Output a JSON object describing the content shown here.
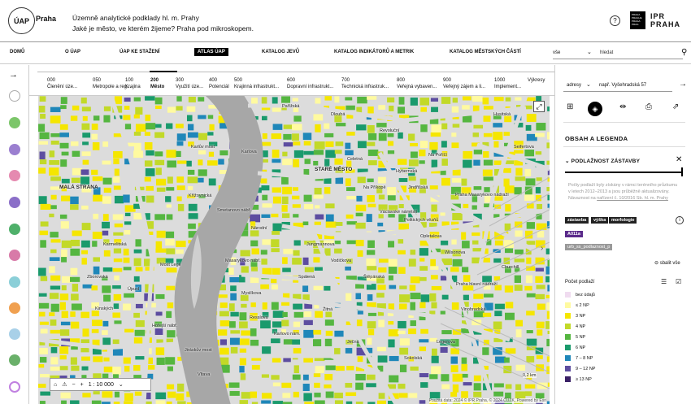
{
  "header": {
    "logo": "ÚAP",
    "logo_city": "Praha",
    "title_line1": "Územně analytické podklady hl. m. Prahy",
    "title_line2": "Jaké je město, ve kterém žijeme? Praha pod mikroskopem.",
    "help": "?",
    "ipr_small": "PRAHA PRAGUE PRAGA PRAG",
    "ipr_line1": "IPR",
    "ipr_line2": "PRAHA"
  },
  "nav": {
    "items": [
      "DOMŮ",
      "O ÚAP",
      "ÚAP KE STAŽENÍ",
      "ATLAS ÚAP",
      "KATALOG JEVŮ",
      "KATALOG INDIKÁTORŮ A METRIK",
      "KATALOG MĚSTSKÝCH ČÁSTÍ"
    ],
    "search_scope": "vše",
    "search_placeholder": "hledat"
  },
  "scale_bar": {
    "items": [
      {
        "num": "000",
        "label": "Členění úze..."
      },
      {
        "num": "050",
        "label": "Metropole a reg..."
      },
      {
        "num": "100",
        "label": "Krajina"
      },
      {
        "num": "200",
        "label": "Město"
      },
      {
        "num": "300",
        "label": "Využití úze..."
      },
      {
        "num": "400",
        "label": "Potenciál"
      },
      {
        "num": "500",
        "label": "Krajinná infrastrukt..."
      },
      {
        "num": "600",
        "label": "Dopravní infrastrukt..."
      },
      {
        "num": "700",
        "label": "Technická infrastruk..."
      },
      {
        "num": "800",
        "label": "Veřejná vybaven..."
      },
      {
        "num": "900",
        "label": "Veřejný zájem a li..."
      },
      {
        "num": "1000",
        "label": "Implement..."
      },
      {
        "num": "",
        "label": "Výkresy"
      }
    ]
  },
  "map": {
    "labels": [
      "MALÁ STRANA",
      "STARÉ MĚSTO",
      "Praha Masarykovo nádraží",
      "Praha hlavní nádraží",
      "Karlův most",
      "Karlova",
      "Národní",
      "Vodičkova",
      "Václavské náměstí",
      "Opletalova",
      "Wilsonova",
      "Žitná",
      "Ječná",
      "Resslova",
      "Na Poříčí",
      "Revoluční",
      "Politických vězňů",
      "Most Legií",
      "Karmelitská",
      "Újezd",
      "Jindřišská",
      "Hybernská",
      "Husitská",
      "Seifertova",
      "Vinohradská",
      "Legerova",
      "Sokolská",
      "Myslíkova",
      "Spálená",
      "Jiráskův most",
      "Křížovnická",
      "Smetanovo nábř.",
      "Masarykovo nábř.",
      "Pařížská",
      "Dlouhá",
      "Celetná",
      "Na Příkopě",
      "Jungmannova",
      "Štěpánská",
      "Karlovo nám.",
      "Hořejší nábř.",
      "Zborovská",
      "Vltava",
      "Kinských",
      "Churchill"
    ],
    "scale_text": "1 : 10 000",
    "attribution": "Použitá data: 2024 © IPR Praha, © 2024 ČÚZK, Powered by Esri",
    "km": "0,2 km",
    "fullscreen": "⤢"
  },
  "right_panel": {
    "search_scope": "adresy",
    "search_placeholder": "např. Vyšehradská 57",
    "section_title": "OBSAH A LEGENDA",
    "layer_title": "PODLAŽNOST ZÁSTAVBY",
    "description": "Počty podlaží byly získány v rámci terénního průzkumu v letech 2012–2013 a jsou průběžně aktualizovány. Návaznost na",
    "description_link": "nařízení č. 10/2016 Sb. hl. m. Prahy",
    "tags": [
      "zástavba",
      "výška",
      "morfologie"
    ],
    "code_tag": "A011a",
    "layer_tag": "urb_ss_podlaznost_p",
    "collapse_all": "sbalit vše",
    "legend_title": "Počet podlaží",
    "legend": [
      {
        "label": "bez údajů",
        "color": "#f0dcf0"
      },
      {
        "label": "≤ 2 NP",
        "color": "#fffaa0"
      },
      {
        "label": "3 NP",
        "color": "#f5e600"
      },
      {
        "label": "4 NP",
        "color": "#c2d928"
      },
      {
        "label": "5 NP",
        "color": "#55b640"
      },
      {
        "label": "6 NP",
        "color": "#1a9a6c"
      },
      {
        "label": "7 – 8 NP",
        "color": "#1f87b9"
      },
      {
        "label": "9 – 12 NP",
        "color": "#5d4da0"
      },
      {
        "label": "≥ 13 NP",
        "color": "#3a2066"
      }
    ]
  }
}
